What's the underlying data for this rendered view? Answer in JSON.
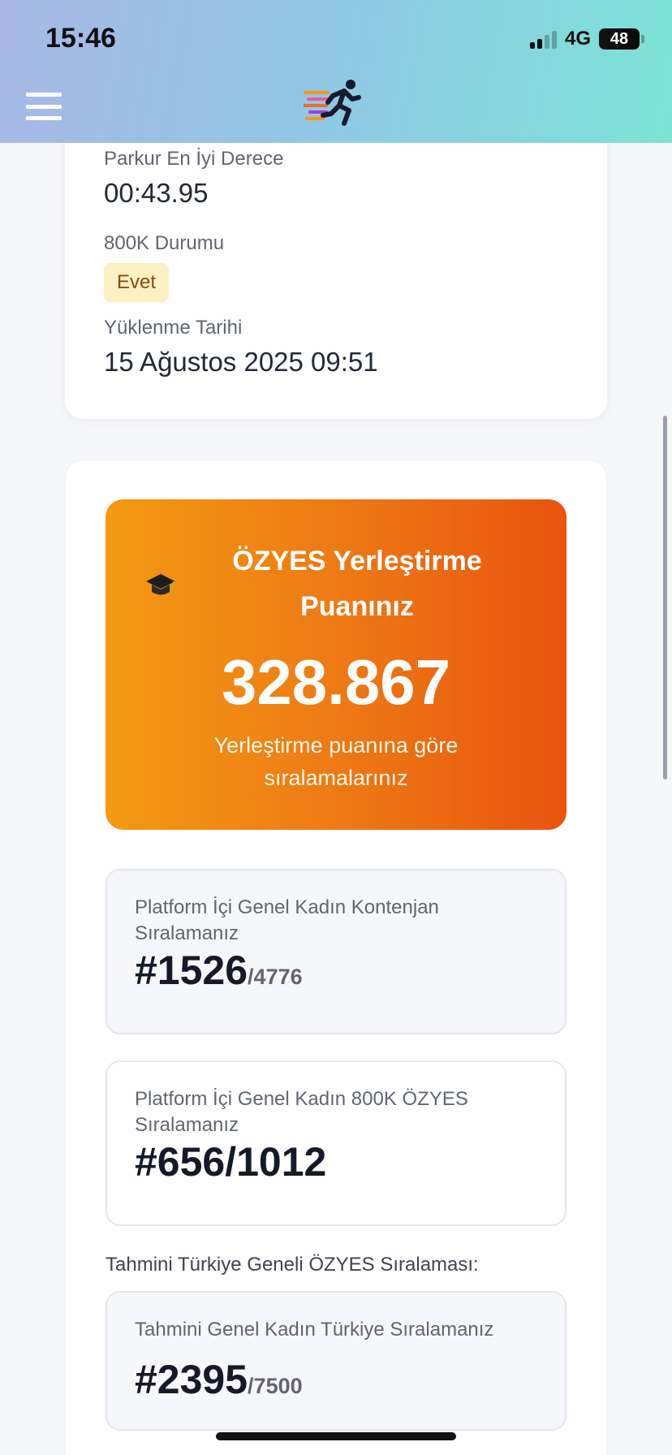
{
  "status_bar": {
    "time": "15:46",
    "network": "4G",
    "battery": "48"
  },
  "details": {
    "best_time_label": "Parkur En İyi Derece",
    "best_time_value": "00:43.95",
    "status_label": "800K Durumu",
    "status_badge": "Evet",
    "upload_label": "Yüklenme Tarihi",
    "upload_value": "15 Ağustos 2025 09:51"
  },
  "score_card": {
    "title": "ÖZYES Yerleştirme Puanınız",
    "score": "328.867",
    "subtitle": "Yerleştirme puanına göre sıralamalarınız"
  },
  "rankings": [
    {
      "label": "Platform İçi Genel Kadın Kontenjan Sıralamanız",
      "rank": "#1526",
      "total": "/4776"
    },
    {
      "label": "Platform İçi Genel Kadın 800K ÖZYES Sıralamanız",
      "rank": "#656/1012",
      "total": ""
    }
  ],
  "estimate_section_label": "Tahmini Türkiye Geneli ÖZYES Sıralaması:",
  "estimate": {
    "label": "Tahmini Genel Kadın Türkiye Sıralamanız",
    "rank": "#2395",
    "total": "/7500"
  },
  "colors": {
    "accent_orange": "#ee7a14",
    "badge_bg": "#fdf0c3",
    "header_gradient_start": "#a9b8e6",
    "header_gradient_end": "#7de3d6"
  },
  "icons": {
    "menu": "hamburger-menu-icon",
    "logo": "runner-logo-icon",
    "cap": "graduation-cap-icon"
  }
}
